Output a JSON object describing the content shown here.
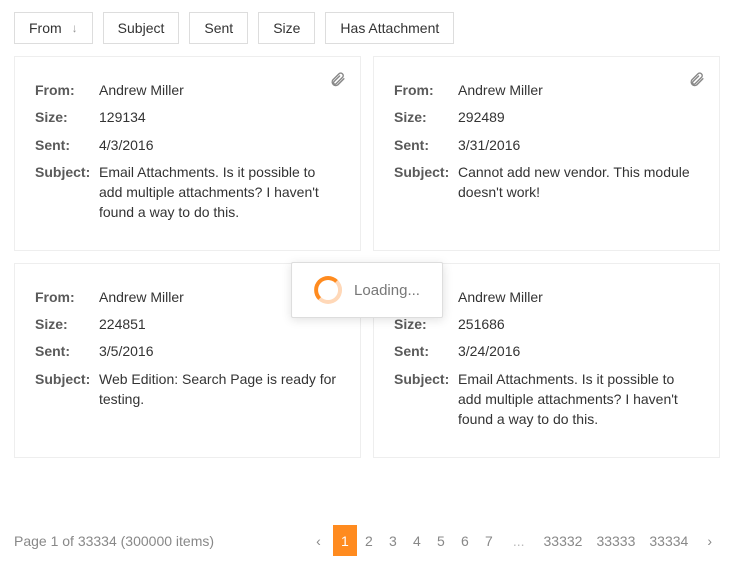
{
  "toolbar": {
    "sort_buttons": [
      {
        "label": "From",
        "dir": "↓"
      },
      {
        "label": "Subject",
        "dir": ""
      },
      {
        "label": "Sent",
        "dir": ""
      },
      {
        "label": "Size",
        "dir": ""
      },
      {
        "label": "Has Attachment",
        "dir": ""
      }
    ]
  },
  "labels": {
    "from": "From:",
    "size": "Size:",
    "sent": "Sent:",
    "subject": "Subject:"
  },
  "cards": [
    {
      "has_attachment": true,
      "from": "Andrew Miller",
      "size": "129134",
      "sent": "4/3/2016",
      "subject": "Email Attachments. Is it possible to add multiple attachments? I haven't found a way to do this."
    },
    {
      "has_attachment": true,
      "from": "Andrew Miller",
      "size": "292489",
      "sent": "3/31/2016",
      "subject": "Cannot add new vendor. This module doesn't work!"
    },
    {
      "has_attachment": false,
      "from": "Andrew Miller",
      "size": "224851",
      "sent": "3/5/2016",
      "subject": "Web Edition: Search Page is ready for testing."
    },
    {
      "has_attachment": false,
      "from": "Andrew Miller",
      "size": "251686",
      "sent": "3/24/2016",
      "subject": "Email Attachments. Is it possible to add multiple attachments? I haven't found a way to do this."
    }
  ],
  "pager": {
    "summary": "Page 1 of 33334 (300000 items)",
    "pages_start": [
      "1",
      "2",
      "3",
      "4",
      "5",
      "6",
      "7"
    ],
    "ellipsis": "...",
    "pages_end": [
      "33332",
      "33333",
      "33334"
    ],
    "active": "1"
  },
  "overlay": {
    "text": "Loading..."
  }
}
